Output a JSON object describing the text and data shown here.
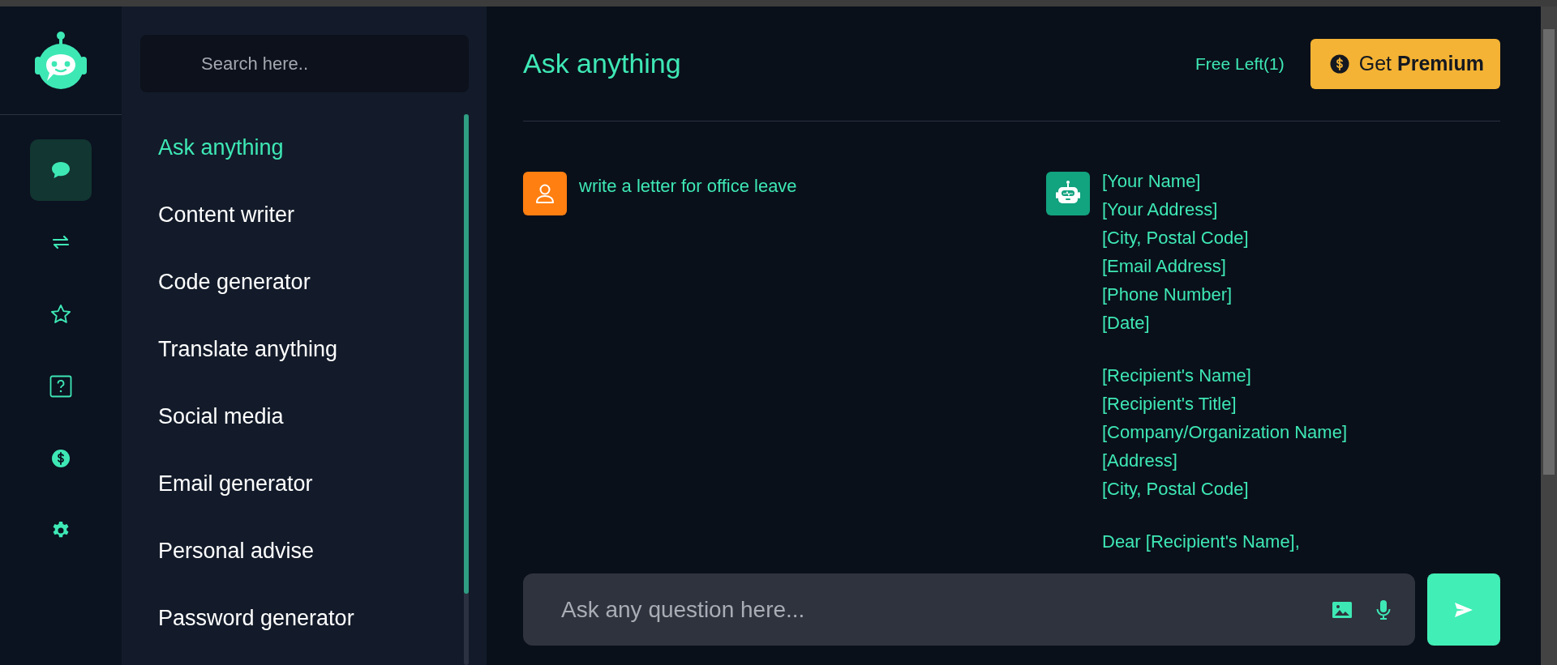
{
  "rail": {
    "items": [
      {
        "kind": "chat",
        "selected": true
      },
      {
        "kind": "swap",
        "selected": false
      },
      {
        "kind": "star",
        "selected": false
      },
      {
        "kind": "help",
        "selected": false
      },
      {
        "kind": "dollar",
        "selected": false
      },
      {
        "kind": "gear",
        "selected": false
      }
    ]
  },
  "sidebar": {
    "search": {
      "placeholder": "Search here.."
    },
    "items": [
      {
        "label": "Ask anything",
        "selected": true
      },
      {
        "label": "Content writer",
        "selected": false
      },
      {
        "label": "Code generator",
        "selected": false
      },
      {
        "label": "Translate anything",
        "selected": false
      },
      {
        "label": "Social media",
        "selected": false
      },
      {
        "label": "Email generator",
        "selected": false
      },
      {
        "label": "Personal advise",
        "selected": false
      },
      {
        "label": "Password generator",
        "selected": false
      }
    ]
  },
  "header": {
    "title": "Ask anything",
    "free_left": "Free Left(1)",
    "premium_button": "Get **Premium**"
  },
  "messages": [
    {
      "kind": "user",
      "text": "write a letter for office leave"
    },
    {
      "kind": "bot",
      "blocks": [
        [
          "[Your Name]",
          "[Your Address]",
          "[City, Postal Code]",
          "[Email Address]",
          "[Phone Number]",
          "[Date]"
        ],
        [
          "[Recipient's Name]",
          "[Recipient's Title]",
          "[Company/Organization Name]",
          "[Address]",
          "[City, Postal Code]"
        ],
        [
          "Dear [Recipient's Name],"
        ]
      ]
    }
  ],
  "composer": {
    "placeholder": "Ask any question here..."
  }
}
